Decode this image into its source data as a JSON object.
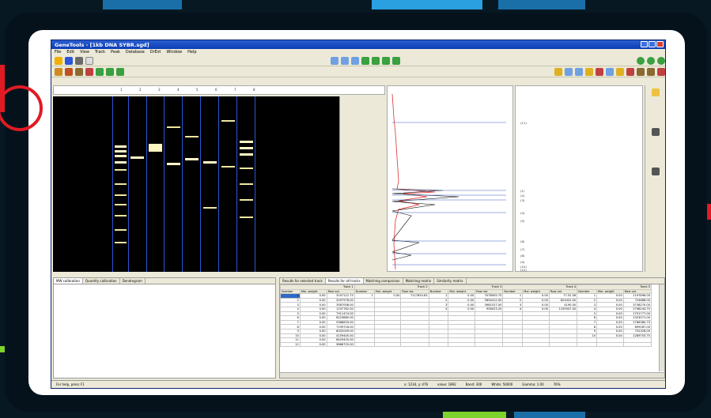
{
  "window": {
    "title": "GeneTools - [1kb DNA SYBR.sgd]"
  },
  "menu": [
    "File",
    "Edit",
    "View",
    "Track",
    "Peak",
    "Database",
    "DrEst",
    "Window",
    "Help"
  ],
  "lanes": [
    "1",
    "2",
    "3",
    "4",
    "5",
    "6",
    "7",
    "8"
  ],
  "peak_labels": [
    "(11)",
    "(1)",
    "(2)",
    "(3)",
    "(4)",
    "(5)",
    "(6)",
    "(7)",
    "(8)",
    "(9)",
    "(10)",
    "(12)"
  ],
  "bottom_left_tabs": [
    "MW calibration",
    "Quantity calibration",
    "Dendrogram"
  ],
  "bottom_right_tabs": [
    "Results for selected track",
    "Results for all tracks",
    "Matching comparison",
    "Matching matrix",
    "Similarity matrix"
  ],
  "results": {
    "tracks": [
      "Track 1",
      "Track 2",
      "Track 3",
      "Track 4",
      "Track 5"
    ],
    "columns": [
      "Number",
      "Mol. weight",
      "Raw vol."
    ],
    "rows": [
      [
        "1",
        "0.00",
        "3197112.75",
        "1",
        "0.00",
        "7127855.63",
        "1",
        "0.00",
        "7078905.75",
        "1",
        "0.00",
        "77.52.56",
        "1",
        "0.00",
        "1197896.00"
      ],
      [
        "2",
        "0.00",
        "2097576.00",
        "",
        "",
        "",
        "2",
        "0.00",
        "5894412.00",
        "2",
        "0.00",
        "824422.00",
        "2",
        "0.00",
        "724688.00"
      ],
      [
        "3",
        "0.00",
        "3587008.00",
        "",
        "",
        "",
        "3",
        "0.00",
        "3981527.00",
        "3",
        "0.00",
        "4190.00",
        "3",
        "0.00",
        "3736270.00"
      ],
      [
        "4",
        "0.00",
        "1197762.00",
        "",
        "",
        "",
        "4",
        "0.00",
        "958023.25",
        "4",
        "0.00",
        "1109507.00",
        "4",
        "0.00",
        "2798244.75"
      ],
      [
        "5",
        "0.00",
        "7911474.00",
        "",
        "",
        "",
        "",
        "",
        "",
        "",
        "",
        "",
        "5",
        "0.00",
        "1791777.00"
      ],
      [
        "6",
        "0.00",
        "8223885.00",
        "",
        "",
        "",
        "",
        "",
        "",
        "",
        "",
        "",
        "6",
        "0.00",
        "1323571.00"
      ],
      [
        "7",
        "0.00",
        "5368633.00",
        "",
        "",
        "",
        "",
        "",
        "",
        "",
        "",
        "",
        "7",
        "0.00",
        "1766380.75"
      ],
      [
        "8",
        "0.00",
        "7199718.00",
        "",
        "",
        "",
        "",
        "",
        "",
        "",
        "",
        "",
        "8",
        "0.00",
        "699287.00"
      ],
      [
        "9",
        "0.00",
        "8002009.00",
        "",
        "",
        "",
        "",
        "",
        "",
        "",
        "",
        "",
        "9",
        "0.00",
        "752326.00"
      ],
      [
        "10",
        "0.00",
        "4159445.00",
        "",
        "",
        "",
        "",
        "",
        "",
        "",
        "",
        "",
        "10",
        "0.00",
        "1289753.75"
      ],
      [
        "11",
        "0.00",
        "8429425.00",
        "",
        "",
        "",
        "",
        "",
        "",
        "",
        "",
        "",
        "",
        "",
        ""
      ],
      [
        "12",
        "0.00",
        "9886720.00",
        "",
        "",
        "",
        "",
        "",
        "",
        "",
        "",
        "",
        "",
        "",
        ""
      ]
    ]
  },
  "status": {
    "help": "For help, press F1",
    "coords": "x: 1234, y: 476",
    "value": "value: 1892",
    "band": "Band: 300",
    "white": "White: 50000",
    "gamma": "Gamma: 1.00",
    "zoom": "76%"
  },
  "colors": {
    "title_bar": "#0b3cb5",
    "ring": "#e01b24",
    "lane_line": "#2b56d8",
    "profile_peak": "#e03030"
  }
}
